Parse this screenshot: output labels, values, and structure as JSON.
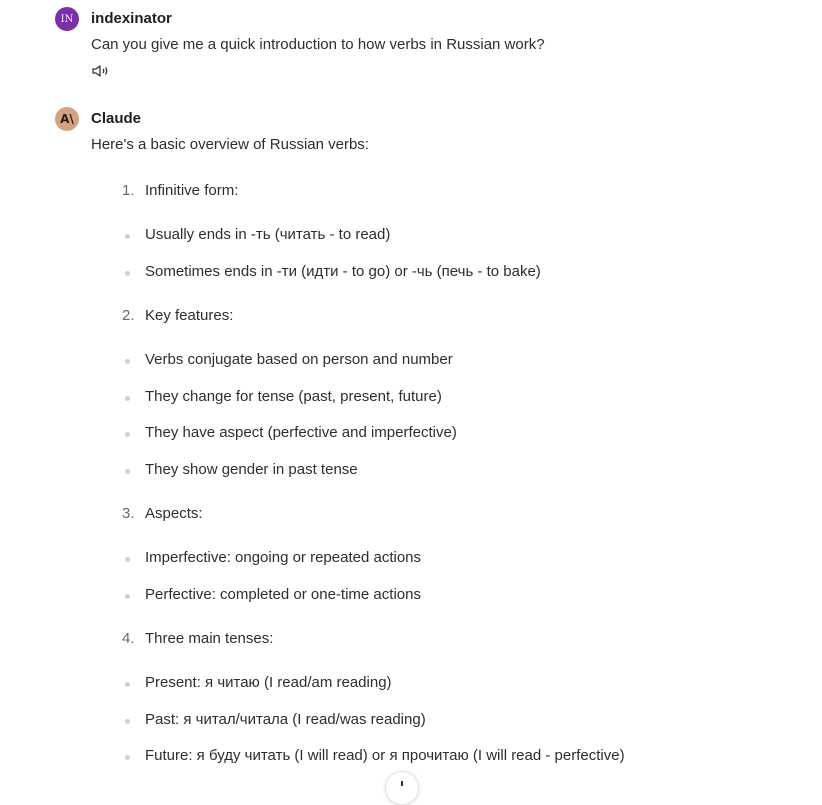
{
  "user_message": {
    "avatar_initials": "IN",
    "author": "indexinator",
    "text": "Can you give me a quick introduction to how verbs in Russian work?",
    "speaker_icon": "speaker-icon"
  },
  "assistant_message": {
    "avatar_text": "A\\",
    "author": "Claude",
    "intro": "Here's a basic overview of Russian verbs:",
    "sections": [
      {
        "number": "1.",
        "title": "Infinitive form:",
        "bullets": [
          "Usually ends in -ть (читать - to read)",
          "Sometimes ends in -ти (идти - to go) or -чь (печь - to bake)"
        ]
      },
      {
        "number": "2.",
        "title": "Key features:",
        "bullets": [
          "Verbs conjugate based on person and number",
          "They change for tense (past, present, future)",
          "They have aspect (perfective and imperfective)",
          "They show gender in past tense"
        ]
      },
      {
        "number": "3.",
        "title": "Aspects:",
        "bullets": [
          "Imperfective: ongoing or repeated actions",
          "Perfective: completed or one-time actions"
        ]
      },
      {
        "number": "4.",
        "title": "Three main tenses:",
        "bullets": [
          "Present: я читаю (I read/am reading)",
          "Past: я читал/читала (I read/was reading)",
          "Future: я буду читать (I will read) or я прочитаю (I will read - perfective)"
        ]
      }
    ]
  },
  "scroll_button_icon": "arrow-down-icon",
  "colors": {
    "user_avatar": "#7b2fa8",
    "assistant_avatar": "#d4a27f"
  }
}
